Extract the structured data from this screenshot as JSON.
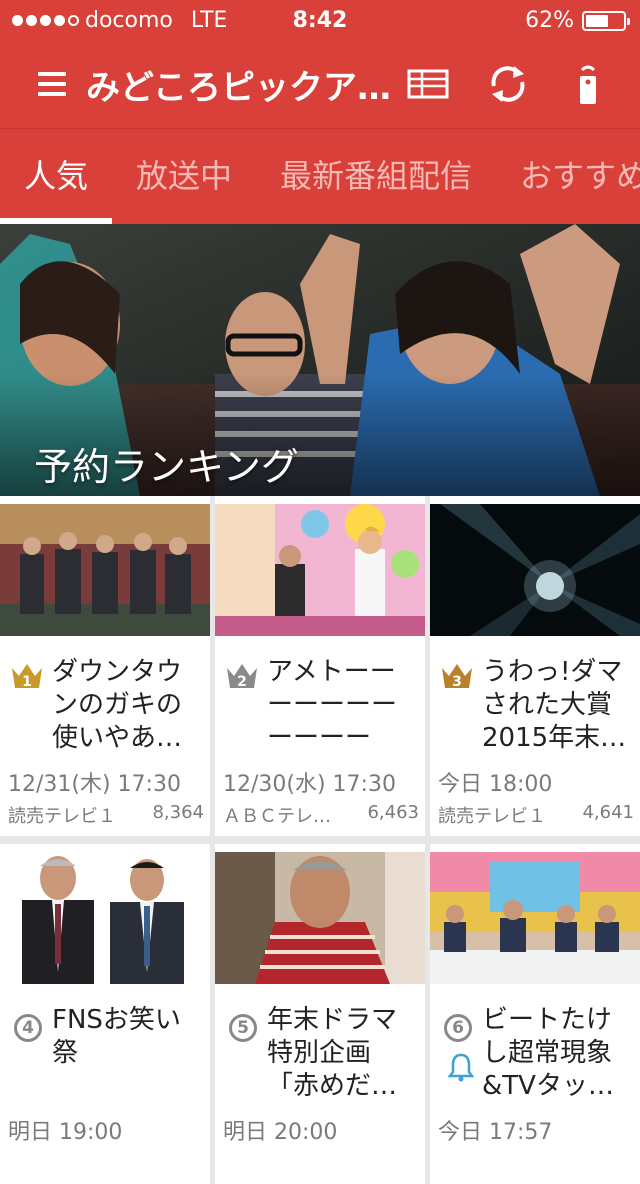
{
  "status_bar": {
    "carrier": "docomo",
    "network": "LTE",
    "time": "8:42",
    "battery": "62%",
    "battery_level": 0.62,
    "signal_bars": 4
  },
  "toolbar": {
    "title": "みどころピックア…",
    "icons": [
      "menu-icon",
      "program-guide-icon",
      "refresh-icon",
      "remote-control-icon"
    ]
  },
  "tabs": [
    "人気",
    "放送中",
    "最新番組配信",
    "おすすめ"
  ],
  "active_tab": 0,
  "hero": {
    "label": "予約ランキング"
  },
  "cards": [
    {
      "rank": "1",
      "rank_style": "gold-crown",
      "title": "ダウンタウンのガキの使いやあ…",
      "time": "12/31(木) 17:30",
      "channel": "読売テレビ１",
      "count": "8,364"
    },
    {
      "rank": "2",
      "rank_style": "silver-crown",
      "title": "アメトーーーーーーーーーーーク…",
      "time": "12/30(水) 17:30",
      "channel": "ＡＢＣテレ…",
      "count": "6,463"
    },
    {
      "rank": "3",
      "rank_style": "bronze-crown",
      "title": "うわっ!ダマされた大賞2015年末…",
      "time": "今日 18:00",
      "channel": "読売テレビ１",
      "count": "4,641"
    },
    {
      "rank": "4",
      "rank_style": "circle",
      "title": "FNSお笑い祭",
      "time": "明日 19:00",
      "channel": "",
      "count": ""
    },
    {
      "rank": "5",
      "rank_style": "circle",
      "title": "年末ドラマ特別企画「赤めだ…",
      "time": "明日 20:00",
      "channel": "",
      "count": ""
    },
    {
      "rank": "6",
      "rank_style": "circle",
      "title": "ビートたけし超常現象&TVタッ…",
      "time": "今日 17:57",
      "channel": "",
      "count": "",
      "reminder": true
    }
  ],
  "colors": {
    "header": "#d9403a",
    "tab_inactive": "#f5b9b4",
    "gold": "#c89a2a",
    "silver": "#8a8a8a",
    "bronze": "#b8812a",
    "bell": "#3ea0d8"
  }
}
